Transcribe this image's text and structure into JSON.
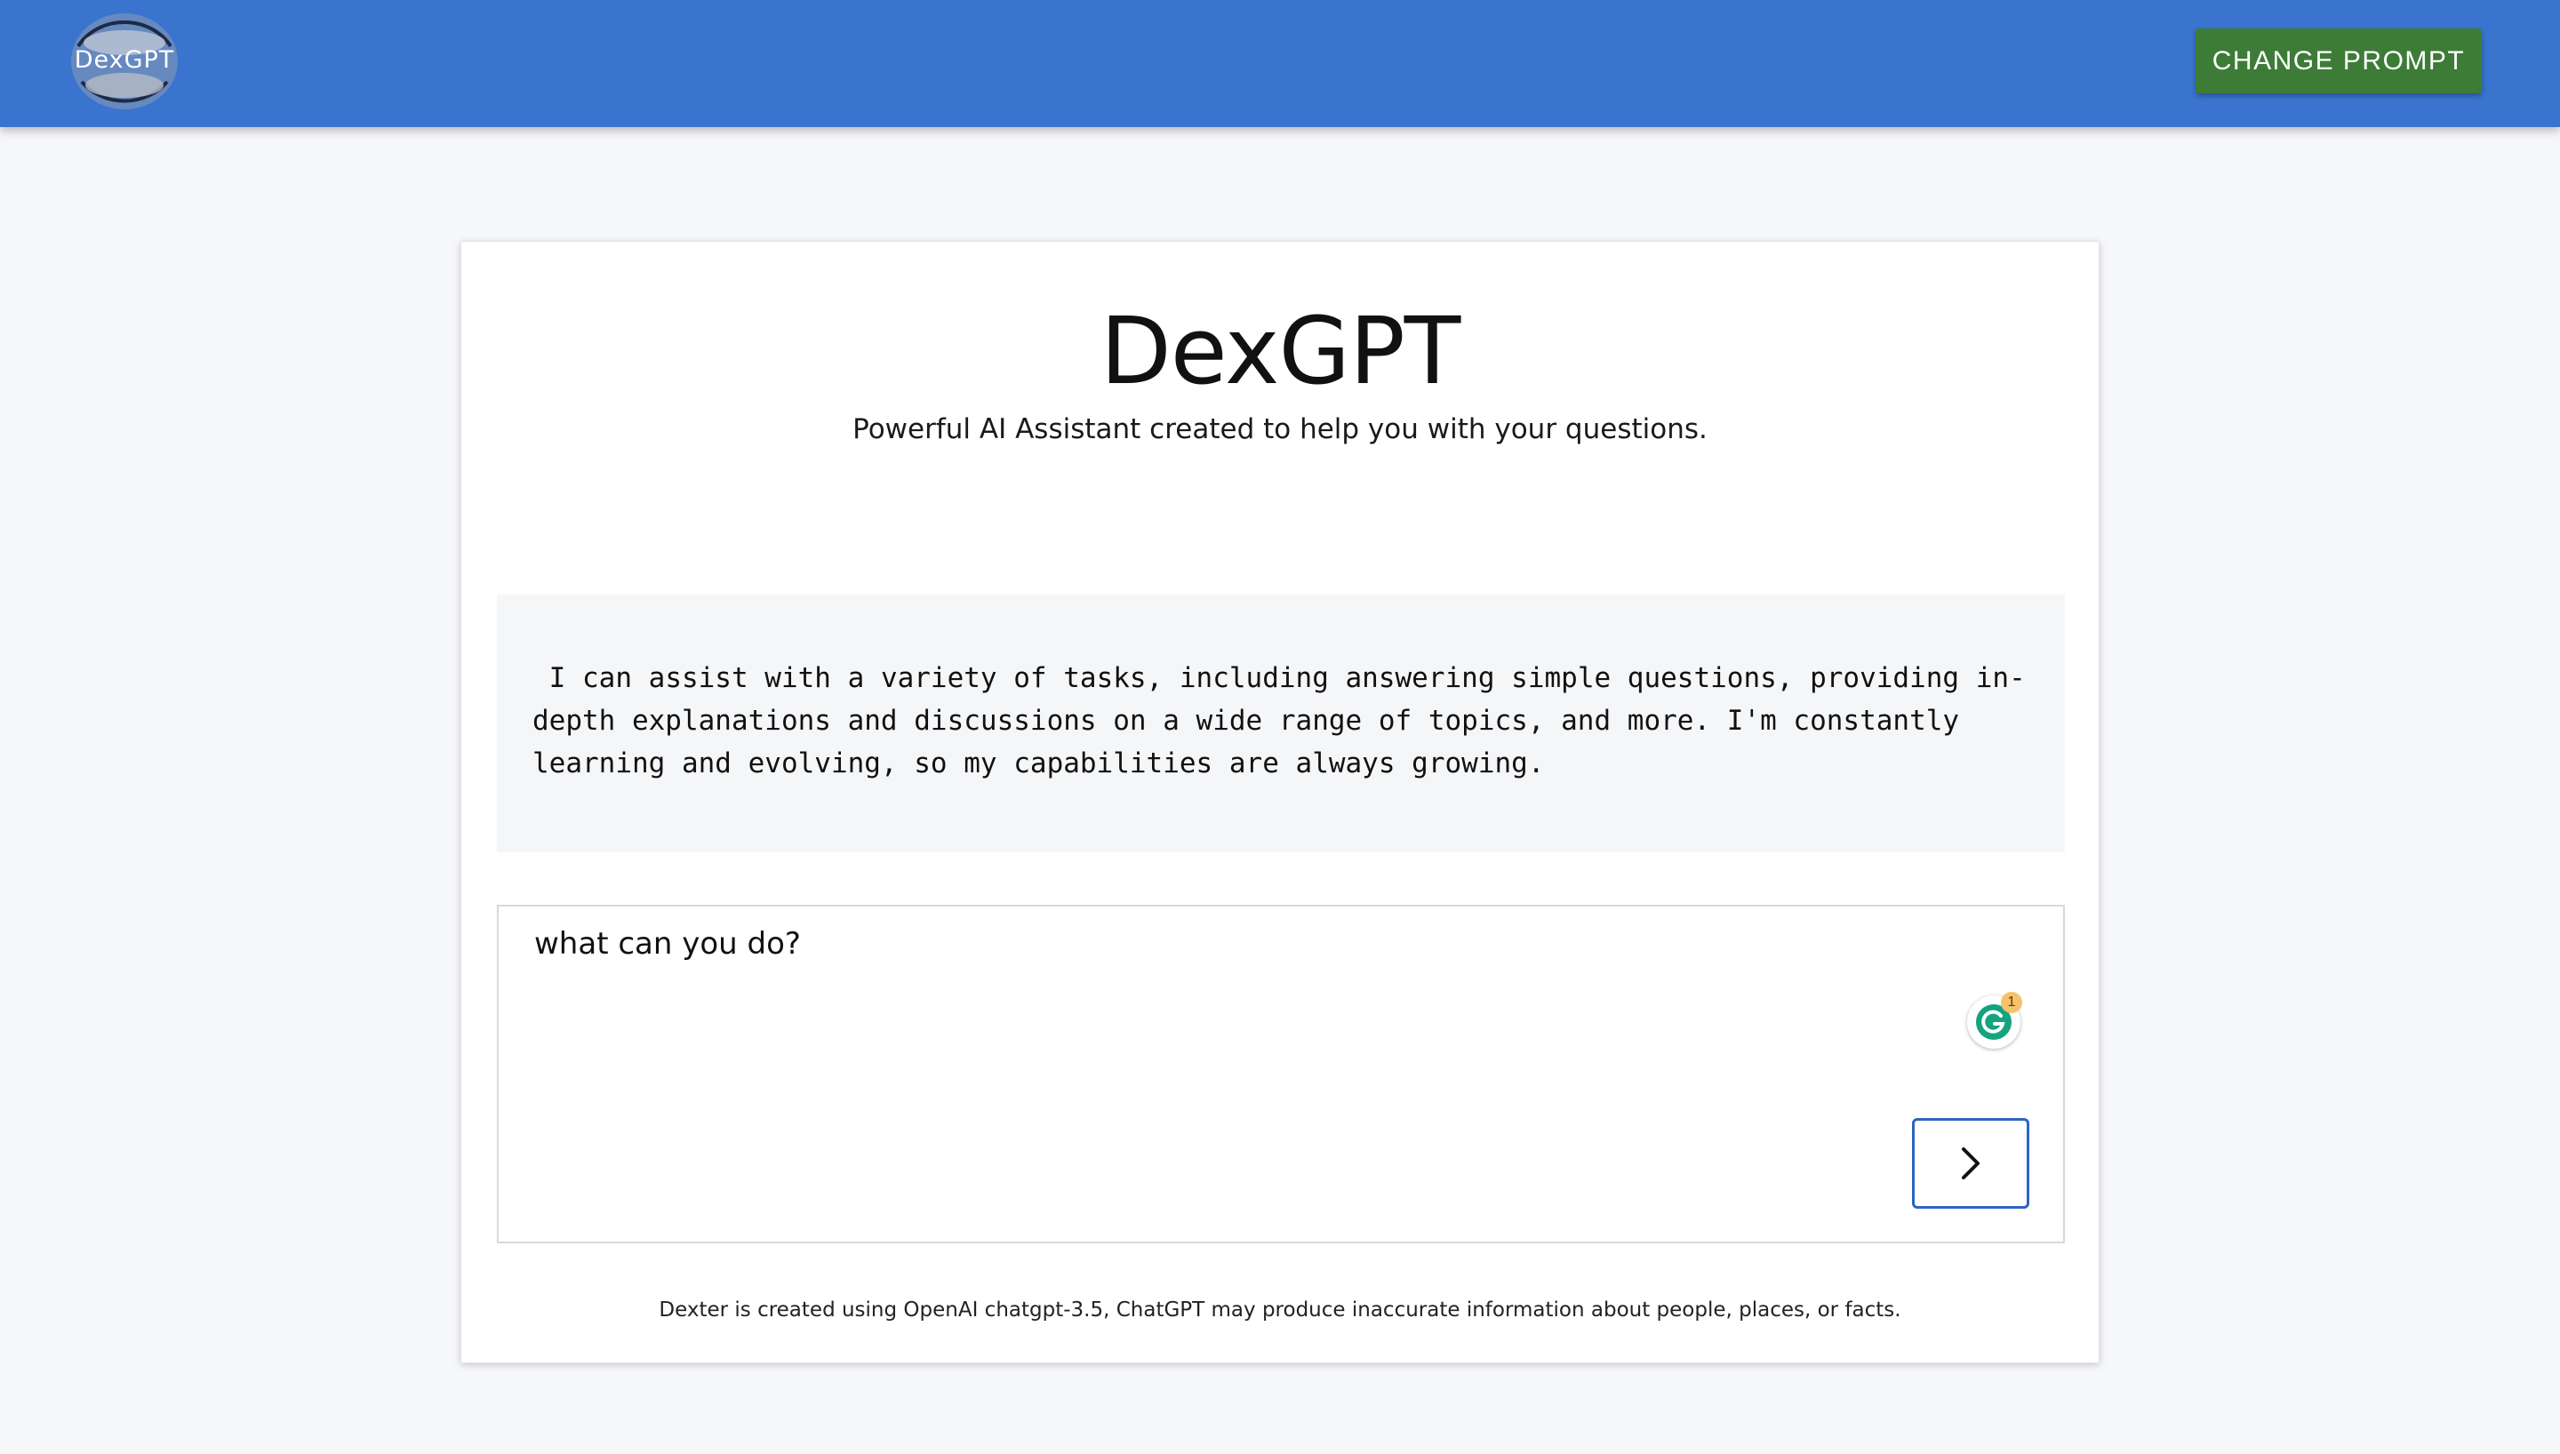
{
  "header": {
    "logo_text": "DexGPT",
    "change_prompt_label": "CHANGE PROMPT"
  },
  "main": {
    "title": "DexGPT",
    "subtitle": "Powerful AI Assistant created to help you with your questions.",
    "response_text": " I can assist with a variety of tasks, including answering simple questions, providing in-depth explanations and discussions on a wide range of topics, and more. I'm constantly learning and evolving, so my capabilities are always growing.",
    "input_value": "what can you do?",
    "grammarly_badge_count": "1",
    "disclaimer": "Dexter is created using OpenAI chatgpt-3.5, ChatGPT may produce inaccurate information about people, places, or facts."
  },
  "colors": {
    "header_bg": "#3a74cf",
    "change_prompt_bg": "#3d7c37",
    "send_border": "#2e63c2"
  },
  "icons": {
    "logo": "dexgpt-logo-icon",
    "grammarly": "grammarly-icon",
    "send": "chevron-right-icon"
  }
}
